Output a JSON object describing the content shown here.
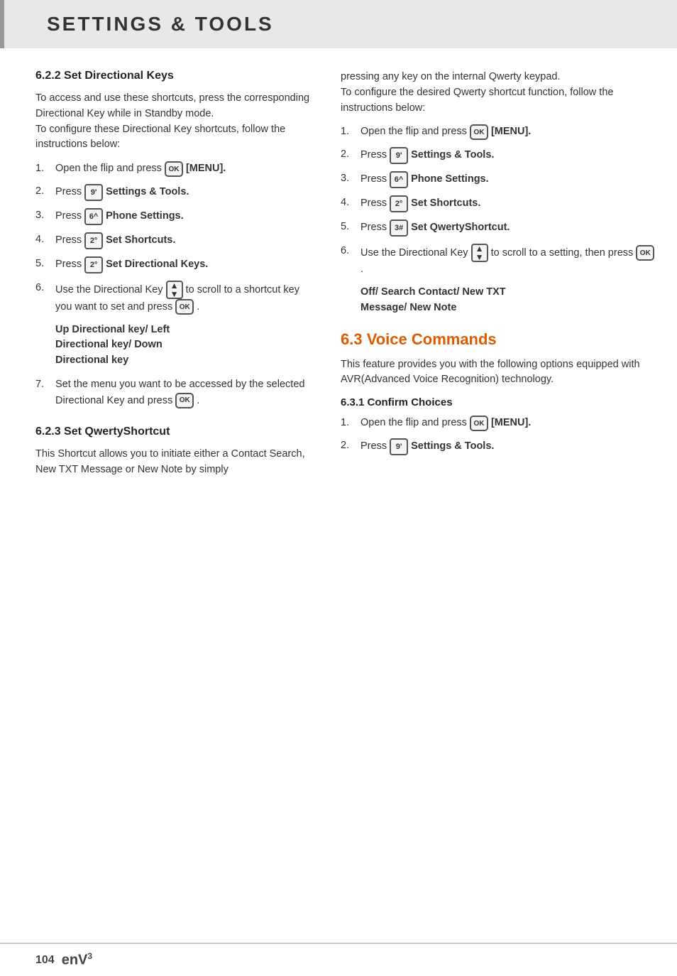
{
  "header": {
    "title": "SETTINGS & TOOLS"
  },
  "left_col": {
    "section_622": {
      "heading": "6.2.2 Set Directional Keys",
      "intro": "To access and use these shortcuts, press the corresponding Directional Key while in Standby mode.\nTo configure these Directional Key shortcuts, follow the instructions below:",
      "steps": [
        {
          "num": "1.",
          "text": "Open the flip and press",
          "key_type": "ok",
          "key_label": "OK",
          "suffix": "[MENU]."
        },
        {
          "num": "2.",
          "text": "Press",
          "key_type": "num",
          "key_label": "9'",
          "bold_text": "Settings & Tools."
        },
        {
          "num": "3.",
          "text": "Press",
          "key_type": "num",
          "key_label": "6^",
          "bold_text": "Phone Settings."
        },
        {
          "num": "4.",
          "text": "Press",
          "key_type": "num",
          "key_label": "2°",
          "bold_text": "Set Shortcuts."
        },
        {
          "num": "5.",
          "text": "Press",
          "key_type": "num",
          "key_label": "2°",
          "bold_text": "Set Directional Keys."
        },
        {
          "num": "6.",
          "text": "Use the Directional Key",
          "key_type": "dir",
          "suffix_text": "to scroll to a shortcut key you want to set and press",
          "key_type2": "ok",
          "key_label2": "OK",
          "end_text": "."
        }
      ],
      "note_6": "Up Directional key/ Left\nDirectional key/ Down\nDirectional key",
      "step_7": {
        "num": "7.",
        "text": "Set the menu you want to be accessed by the selected Directional Key and press",
        "key_type": "ok",
        "key_label": "OK",
        "end_text": "."
      }
    },
    "section_623": {
      "heading": "6.2.3 Set QwertyShortcut",
      "intro": "This Shortcut allows you to initiate either a Contact Search, New TXT Message or New Note by simply"
    }
  },
  "right_col": {
    "intro_continued": "pressing any key on the internal Qwerty keypad.\nTo configure the desired Qwerty shortcut function, follow the instructions below:",
    "steps": [
      {
        "num": "1.",
        "text": "Open the flip and press",
        "key_type": "ok",
        "key_label": "OK",
        "suffix": "[MENU]."
      },
      {
        "num": "2.",
        "text": "Press",
        "key_type": "num",
        "key_label": "9'",
        "bold_text": "Settings & Tools."
      },
      {
        "num": "3.",
        "text": "Press",
        "key_type": "num",
        "key_label": "6^",
        "bold_text": "Phone Settings."
      },
      {
        "num": "4.",
        "text": "Press",
        "key_type": "num",
        "key_label": "2°",
        "bold_text": "Set Shortcuts."
      },
      {
        "num": "5.",
        "text": "Press",
        "key_type": "num",
        "key_label": "3#",
        "bold_text": "Set QwertyShortcut."
      },
      {
        "num": "6.",
        "text": "Use the Directional Key",
        "key_type": "dir",
        "suffix_text": "to scroll to a setting, then press",
        "key_type2": "ok",
        "key_label2": "OK",
        "end_text": "."
      }
    ],
    "note_6": "Off/ Search Contact/ New TXT\nMessage/ New Note",
    "section_63": {
      "heading": "6.3 Voice Commands",
      "intro": "This feature provides you with the following options equipped with AVR(Advanced Voice Recognition) technology."
    },
    "section_631": {
      "heading": "6.3.1 Confirm Choices",
      "steps": [
        {
          "num": "1.",
          "text": "Open the flip and press",
          "key_type": "ok",
          "key_label": "OK",
          "suffix": "[MENU]."
        },
        {
          "num": "2.",
          "text": "Press",
          "key_type": "num",
          "key_label": "9'",
          "bold_text": "Settings & Tools."
        }
      ]
    }
  },
  "footer": {
    "page_number": "104",
    "brand": "enV",
    "brand_sup": "3"
  }
}
